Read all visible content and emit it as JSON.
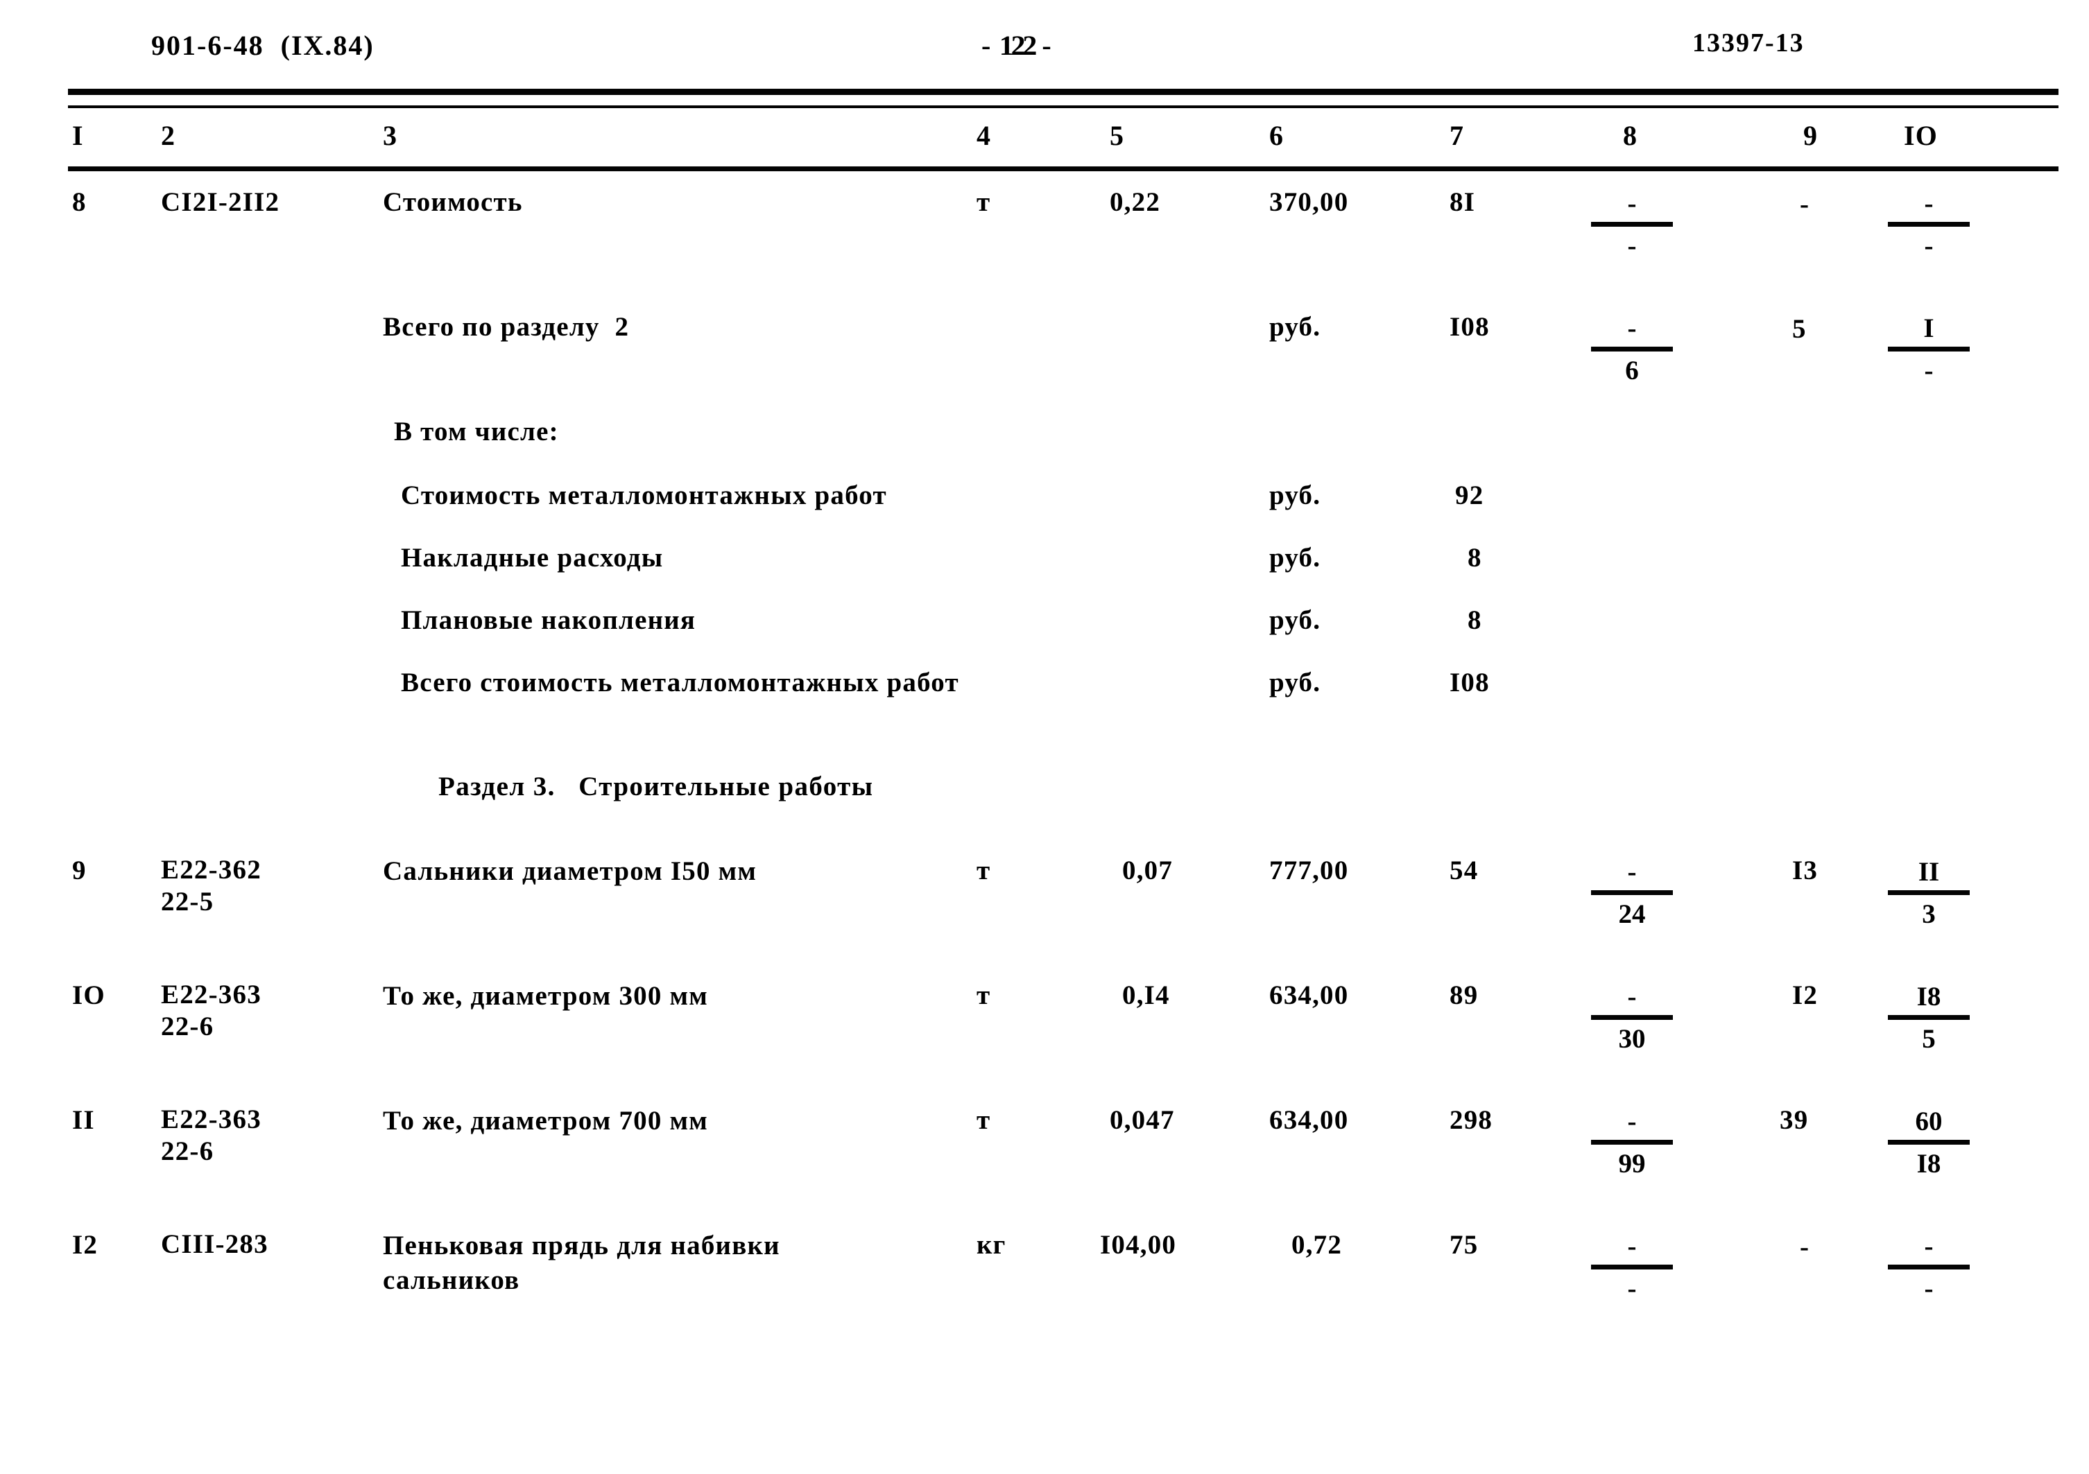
{
  "header": {
    "left": "901-6-48  (IX.84)",
    "page_dash_left": "-",
    "page_number": "122",
    "page_dash_right": "-",
    "right": "13397-13"
  },
  "table": {
    "column_headers": [
      "I",
      "2",
      "3",
      "4",
      "5",
      "6",
      "7",
      "8",
      "9",
      "IO"
    ],
    "rows": [
      {
        "no": "8",
        "code": "CI2I-2II2",
        "description": "Стоимость",
        "unit": "т",
        "qty": "0,22",
        "price": "370,00",
        "sum": "8I",
        "col8_top": "-",
        "col8_bot": "-",
        "col9": "-",
        "col10_top": "-",
        "col10_bot": "-"
      },
      {
        "no": "",
        "code": "",
        "description": "Всего по разделу  2",
        "unit": "",
        "qty": "",
        "price": "руб.",
        "sum": "I08",
        "col8_top": "-",
        "col8_bot": "6",
        "col9": "5",
        "col10_top": "I",
        "col10_bot": "-"
      }
    ],
    "breakdown_label": "В том числе:",
    "breakdown": [
      {
        "label": "Стоимость металломонтажных работ",
        "unit": "руб.",
        "value": "92"
      },
      {
        "label": "Накладные расходы",
        "unit": "руб.",
        "value": "8"
      },
      {
        "label": "Плановые накопления",
        "unit": "руб.",
        "value": "8"
      },
      {
        "label": "Всего стоимость металломонтажных работ",
        "unit": "руб.",
        "value": "I08"
      }
    ],
    "section3_title": "Раздел 3.   Строительные работы",
    "section3_rows": [
      {
        "no": "9",
        "code_line1": "E22-362",
        "code_line2": "22-5",
        "description_line1": "Сальники диаметром I50 мм",
        "description_line2": "",
        "unit": "т",
        "qty": "0,07",
        "price": "777,00",
        "sum": "54",
        "col8_top": "-",
        "col8_bot": "24",
        "col9": "I3",
        "col10_top": "II",
        "col10_bot": "3"
      },
      {
        "no": "IO",
        "code_line1": "E22-363",
        "code_line2": "22-6",
        "description_line1": "То же, диаметром 300 мм",
        "description_line2": "",
        "unit": "т",
        "qty": "0,I4",
        "price": "634,00",
        "sum": "89",
        "col8_top": "-",
        "col8_bot": "30",
        "col9": "I2",
        "col10_top": "I8",
        "col10_bot": "5"
      },
      {
        "no": "II",
        "code_line1": "E22-363",
        "code_line2": "22-6",
        "description_line1": "То же, диаметром 700 мм",
        "description_line2": "",
        "unit": "т",
        "qty": "0,047",
        "price": "634,00",
        "sum": "298",
        "col8_top": "-",
        "col8_bot": "99",
        "col9": "39",
        "col10_top": "60",
        "col10_bot": "I8"
      },
      {
        "no": "I2",
        "code_line1": "CIII-283",
        "code_line2": "",
        "description_line1": "Пеньковая прядь для набивки",
        "description_line2": "сальников",
        "unit": "кг",
        "qty": "I04,00",
        "price": "0,72",
        "sum": "75",
        "col8_top": "-",
        "col8_bot": "-",
        "col9": "-",
        "col10_top": "-",
        "col10_bot": "-"
      }
    ]
  }
}
